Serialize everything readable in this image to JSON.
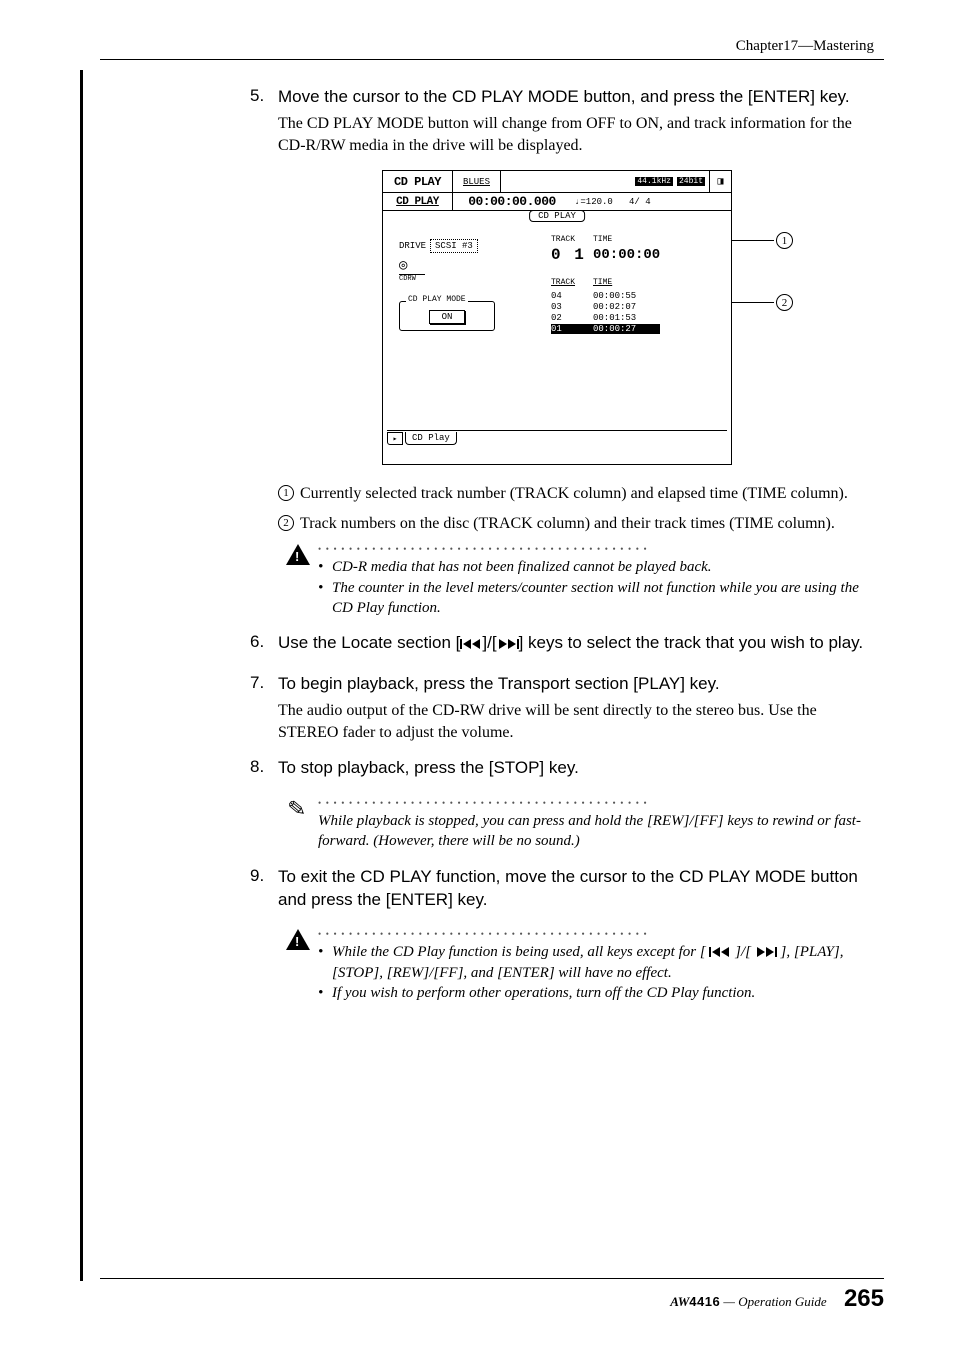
{
  "header": {
    "chapter": "Chapter17—Mastering"
  },
  "step5": {
    "num": "5.",
    "head": "Move the cursor to the CD PLAY MODE button, and press the [ENTER] key.",
    "desc": "The CD PLAY MODE button will change from OFF to ON, and track information for the CD-R/RW media in the drive will be displayed."
  },
  "figure": {
    "title_left": "CD PLAY",
    "title_song": "BLUES",
    "khz_badge": "44.1kHz",
    "bit_badge": "24bit",
    "sub_left": "CD PLAY",
    "sub_time": "00:00:00.000",
    "tempo": "♩=120.0",
    "ratio": "4/ 4",
    "speaker": "◨",
    "tab": "CD PLAY",
    "drive_label": "DRIVE",
    "drive_value": "SCSI #3",
    "cdrw_label": "CDRW",
    "mode_label": "CD PLAY MODE",
    "mode_btn": "ON",
    "rc_h1": "TRACK",
    "rc_h2": "TIME",
    "big_track": "0 1",
    "big_time": "00:00:00",
    "tl_h1": "TRACK",
    "tl_h2": "TIME",
    "rows": [
      {
        "trk": "04",
        "time": "00:00:55",
        "sel": false
      },
      {
        "trk": "03",
        "time": "00:02:07",
        "sel": false
      },
      {
        "trk": "02",
        "time": "00:01:53",
        "sel": false
      },
      {
        "trk": "01",
        "time": "00:00:27",
        "sel": true
      }
    ],
    "bottom_tab": "CD Play",
    "callout1": "1",
    "callout2": "2"
  },
  "annot1": {
    "num": "1",
    "text": "Currently selected track number (TRACK column) and elapsed time (TIME column)."
  },
  "annot2": {
    "num": "2",
    "text": "Track numbers on the disc (TRACK column) and their track times (TIME column)."
  },
  "warn1": {
    "items": [
      "CD-R media that has not been finalized cannot be played back.",
      "The counter in the level meters/counter section will not function while you are using the CD Play function."
    ]
  },
  "step6": {
    "num": "6.",
    "head_a": "Use the Locate section [",
    "head_b": "]/[",
    "head_c": "] keys to select the track that you wish to play."
  },
  "step7": {
    "num": "7.",
    "head": "To begin playback, press the Transport section [PLAY] key.",
    "desc": "The audio output of the CD-RW drive will be sent directly to the stereo bus. Use the STEREO fader to adjust the volume."
  },
  "step8": {
    "num": "8.",
    "head": "To stop playback, press the [STOP] key."
  },
  "tip": {
    "text": "While playback is stopped, you can press and hold the [REW]/[FF] keys to rewind or fast-forward. (However, there will be no sound.)"
  },
  "step9": {
    "num": "9.",
    "head": "To exit the CD PLAY function, move the cursor to the CD PLAY MODE button and press the [ENTER] key."
  },
  "warn2": {
    "item1a": "While the CD Play function is being used, all keys except for [ ",
    "item1b": " ]/[ ",
    "item1c": " ], [PLAY], [STOP], [REW]/[FF], and [ENTER] will have no effect.",
    "item2": "If you wish to perform other operations, turn off the CD Play function."
  },
  "footer": {
    "model": "4416",
    "guide": " — Operation Guide",
    "page": "265"
  }
}
